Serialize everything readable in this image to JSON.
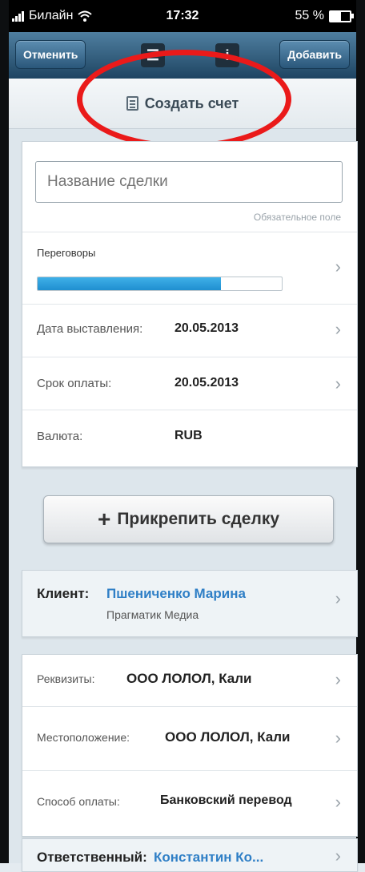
{
  "status_bar": {
    "carrier": "Билайн",
    "time": "17:32",
    "battery": "55 %"
  },
  "nav": {
    "cancel_label": "Отменить",
    "add_label": "Добавить",
    "icons": [
      "list-icon",
      "info-icon"
    ]
  },
  "invoice": {
    "create_label": "Создать счет",
    "icon": "document-icon"
  },
  "deal_form": {
    "name_placeholder": "Название сделки",
    "required_note": "Обязательное поле",
    "stage_label": "Переговоры",
    "stage_progress_percent": 75,
    "issue_date_label": "Дата выставления:",
    "issue_date_value": "20.05.2013",
    "due_date_label": "Срок оплаты:",
    "due_date_value": "20.05.2013",
    "currency_label": "Валюта:",
    "currency_value": "RUB"
  },
  "attach_deal": {
    "plus": "+",
    "label": "Прикрепить сделку"
  },
  "client": {
    "label": "Клиент:",
    "name": "Пшениченко Марина",
    "company": "Прагматик Медиа"
  },
  "details": {
    "requisites_label": "Реквизиты:",
    "requisites_value": "ООО ЛОЛОЛ, Кали",
    "location_label": "Местоположение:",
    "location_value": "ООО ЛОЛОЛ, Кали",
    "payment_label": "Способ оплаты:",
    "payment_value": "Банковский перевод"
  },
  "responsible": {
    "label": "Ответственный:",
    "name": "Константин Ко..."
  },
  "chevron": "›",
  "colors": {
    "nav_bar": "#2f5a7c",
    "link_blue": "#2f7fc6",
    "progress_blue": "#2a9ad8",
    "highlight_red": "#ea1a1a"
  }
}
